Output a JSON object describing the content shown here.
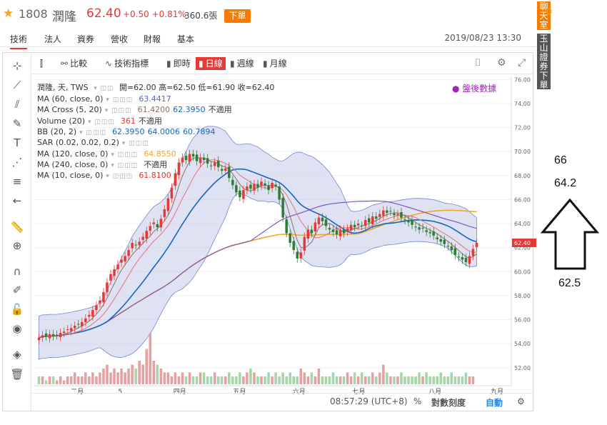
{
  "header": {
    "code": "1808",
    "name": "潤隆",
    "price": "62.40",
    "change": "+0.50 +0.81%",
    "volume": "360.6張",
    "order_button": "下單"
  },
  "tabs": {
    "items": [
      "技術",
      "法人",
      "資券",
      "營收",
      "財報",
      "基本"
    ],
    "datetime": "2019/08/23 13:30"
  },
  "toolbar": {
    "compare": "比較",
    "indicators": "技術指標",
    "intraday": "即時",
    "daily": "日線",
    "weekly": "週線",
    "monthly": "月線"
  },
  "legend": {
    "title": "潤隆, 天, TWS",
    "open_label": "開=62.00",
    "high_label": "高=62.50",
    "low_label": "低=61.90",
    "close_label": "收=62.40",
    "after_hours": "盤後數據",
    "rows": [
      {
        "name": "MA (60, close, 0)",
        "values": [
          {
            "t": "63.4417",
            "c": "#5c6bc0"
          }
        ]
      },
      {
        "name": "MA Cross (5, 20)",
        "values": [
          {
            "t": "61.4200",
            "c": "#8d6e63"
          },
          {
            "t": "62.3950",
            "c": "#1565c0"
          },
          {
            "t": "不適用",
            "c": "#333333"
          }
        ]
      },
      {
        "name": "Volume (20)",
        "values": [
          {
            "t": "361",
            "c": "#e53935"
          },
          {
            "t": "不適用",
            "c": "#333333"
          }
        ]
      },
      {
        "name": "BB (20, 2)",
        "values": [
          {
            "t": "62.3950",
            "c": "#1565c0"
          },
          {
            "t": "64.0006",
            "c": "#1565c0"
          },
          {
            "t": "60.7894",
            "c": "#1565c0"
          }
        ]
      },
      {
        "name": "SAR (0.02, 0.02, 0.2)",
        "values": []
      },
      {
        "name": "MA (120, close, 0)",
        "values": [
          {
            "t": "64.8550",
            "c": "#f5a623"
          }
        ]
      },
      {
        "name": "MA (240, close, 0)",
        "values": [
          {
            "t": "不適用",
            "c": "#333333"
          }
        ]
      },
      {
        "name": "MA (10, close, 0)",
        "values": [
          {
            "t": "61.8100",
            "c": "#e53935"
          }
        ]
      }
    ]
  },
  "footer": {
    "time": "08:57:29 (UTC+8)",
    "percent": "%",
    "log": "對數刻度",
    "auto": "自動"
  },
  "side": {
    "chat": "聊天室",
    "esun": "玉山證券下單"
  },
  "annotations": {
    "top": "66",
    "mid": "64.2",
    "bottom": "62.5"
  },
  "chart_data": {
    "type": "candlestick",
    "y_ticks": [
      52,
      54,
      56,
      58,
      60,
      62,
      64,
      66,
      68,
      70,
      72,
      74,
      76
    ],
    "ylim": [
      50.5,
      76.2
    ],
    "x_labels": [
      "二月",
      "5",
      "四月",
      "五月",
      "六月",
      "七月",
      "八月",
      "九月"
    ],
    "last_price_label": "62.40",
    "series_colors": {
      "up": "#e53935",
      "down": "#2e7d32",
      "bb_fill": "#c5cae9",
      "bb_line": "#7986cb",
      "ma20": "#1565c0",
      "ma60": "#7e57c2",
      "ma120": "#f5a623",
      "ma5": "#8d6e63",
      "ma10": "#e57373",
      "sar": "#1a237e",
      "vol_up": "#e6a0a0",
      "vol_down": "#a5d6a7"
    },
    "closes": [
      54.5,
      54.7,
      54.6,
      54.8,
      54.6,
      54.7,
      54.9,
      55.0,
      55.2,
      55.3,
      55.5,
      55.6,
      55.8,
      56.1,
      56.4,
      56.8,
      57.2,
      57.6,
      58.3,
      59.1,
      59.8,
      60.2,
      60.6,
      61.0,
      61.3,
      61.8,
      62.4,
      62.2,
      62.5,
      62.9,
      63.4,
      63.8,
      64.1,
      63.7,
      64.4,
      65.2,
      66.1,
      67.0,
      68.2,
      69.1,
      69.5,
      69.3,
      69.8,
      69.6,
      69.2,
      69.5,
      69.3,
      69.0,
      68.8,
      69.1,
      68.7,
      68.4,
      68.6,
      67.8,
      67.2,
      66.6,
      66.2,
      66.8,
      67.1,
      66.9,
      67.3,
      67.0,
      67.5,
      67.2,
      66.8,
      67.4,
      67.1,
      66.0,
      64.5,
      63.2,
      62.4,
      61.8,
      61.1,
      61.6,
      62.9,
      63.5,
      63.2,
      64.1,
      64.5,
      64.2,
      63.8,
      63.5,
      63.3,
      63.1,
      63.5,
      63.2,
      63.6,
      63.9,
      63.7,
      64.0,
      63.8,
      64.3,
      64.1,
      64.6,
      64.4,
      64.8,
      65.1,
      64.9,
      65.0,
      64.7,
      64.8,
      64.5,
      64.3,
      64.1,
      63.9,
      63.7,
      63.5,
      63.6,
      63.3,
      63.2,
      63.0,
      62.7,
      62.5,
      62.3,
      62.1,
      61.8,
      61.4,
      61.2,
      61.0,
      60.8,
      61.3,
      61.9,
      62.4
    ],
    "volumes": [
      2,
      2,
      1,
      2,
      2,
      1,
      2,
      1,
      2,
      2,
      3,
      2,
      2,
      3,
      2,
      3,
      2,
      3,
      4,
      5,
      3,
      4,
      3,
      4,
      3,
      4,
      5,
      4,
      6,
      5,
      9,
      13,
      6,
      5,
      4,
      3,
      3,
      2,
      3,
      2,
      3,
      2,
      3,
      2,
      2,
      3,
      3,
      2,
      2,
      3,
      2,
      2,
      2,
      3,
      2,
      2,
      3,
      2,
      3,
      4,
      3,
      2,
      2,
      2,
      3,
      2,
      3,
      2,
      3,
      2,
      3,
      2,
      2,
      4,
      3,
      2,
      3,
      2,
      4,
      2,
      2,
      2,
      3,
      2,
      2,
      2,
      3,
      2,
      3,
      2,
      3,
      2,
      2,
      3,
      2,
      3,
      5,
      3,
      2,
      2,
      2,
      3,
      2,
      2,
      2,
      2,
      3,
      2,
      3,
      2,
      2,
      2,
      3,
      2,
      2,
      3,
      2,
      2,
      2,
      3,
      2,
      2
    ]
  }
}
